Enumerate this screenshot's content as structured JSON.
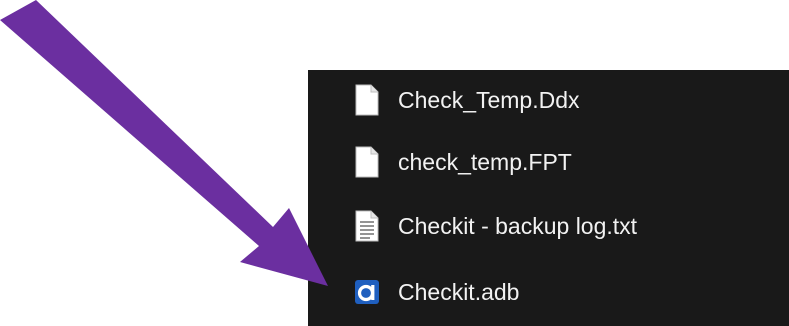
{
  "file_list": {
    "items": [
      {
        "name": "Check_Temp.Ddx",
        "icon": "blank-file-icon"
      },
      {
        "name": "check_temp.FPT",
        "icon": "blank-file-icon"
      },
      {
        "name": "Checkit - backup log.txt",
        "icon": "text-file-icon"
      },
      {
        "name": "Checkit.adb",
        "icon": "advantage-database-icon"
      }
    ]
  },
  "annotation": {
    "arrow_color": "#6b2fa0",
    "icon_name": "pointer-arrow"
  },
  "colors": {
    "panel_background": "#191919",
    "text": "#f2f2f2",
    "app_icon_blue": "#1f5fbf"
  }
}
